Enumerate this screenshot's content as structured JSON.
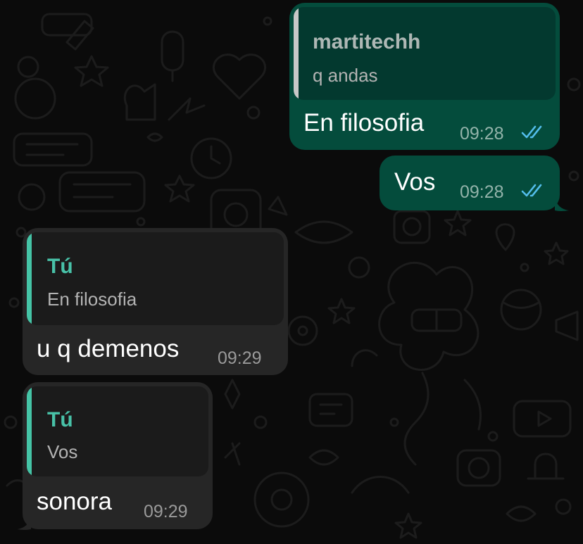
{
  "colors": {
    "background": "#0b0b0b",
    "outgoing_bubble": "#044c3c",
    "incoming_bubble": "#262626",
    "quote_bar_outgoing": "#c8c8c8",
    "quote_bar_incoming": "#45c4a6",
    "quote_author_outgoing": "#aeb8b5",
    "quote_author_incoming": "#48c2a8",
    "read_ticks": "#53bdeb"
  },
  "messages": [
    {
      "direction": "outgoing",
      "reply_to": {
        "author": "martitechh",
        "text": "q andas"
      },
      "text": "En filosofia",
      "time": "09:28",
      "status_icon": "double-check-read-icon"
    },
    {
      "direction": "outgoing",
      "text": "Vos",
      "time": "09:28",
      "status_icon": "double-check-read-icon"
    },
    {
      "direction": "incoming",
      "reply_to": {
        "author": "Tú",
        "text": "En filosofia"
      },
      "text": "u q demenos",
      "time": "09:29"
    },
    {
      "direction": "incoming",
      "reply_to": {
        "author": "Tú",
        "text": "Vos"
      },
      "text": "sonora",
      "time": "09:29"
    }
  ]
}
